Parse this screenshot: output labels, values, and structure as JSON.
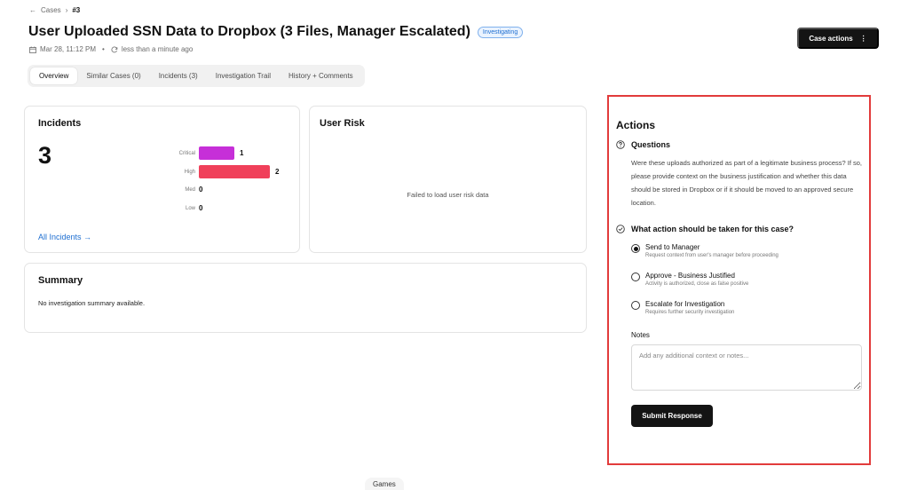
{
  "breadcrumb": {
    "back_icon": "arrow-left-icon",
    "parent": "Cases",
    "separator": "›",
    "current": "#3"
  },
  "case": {
    "title": "User Uploaded SSN Data to Dropbox (3 Files, Manager Escalated)",
    "status": "Investigating",
    "date": "Mar 28, 11:12 PM",
    "dot": "•",
    "updated": "less than a minute ago"
  },
  "header": {
    "case_actions_label": "Case actions",
    "more_icon": "⋮"
  },
  "tabs": [
    {
      "label": "Overview",
      "active": true
    },
    {
      "label": "Similar Cases (0)",
      "active": false
    },
    {
      "label": "Incidents (3)",
      "active": false
    },
    {
      "label": "Investigation Trail",
      "active": false
    },
    {
      "label": "History + Comments",
      "active": false
    }
  ],
  "incidents": {
    "title": "Incidents",
    "total": "3",
    "severities": [
      {
        "label": "Critical",
        "count": 1,
        "color": "#c62fd8"
      },
      {
        "label": "High",
        "count": 2,
        "color": "#f0405a"
      },
      {
        "label": "Med",
        "count": 0,
        "color": "#f0a040"
      },
      {
        "label": "Low",
        "count": 0,
        "color": "#4caf50"
      }
    ],
    "link": "All Incidents →"
  },
  "user_risk": {
    "title": "User Risk",
    "message": "Failed to load user risk data"
  },
  "summary": {
    "title": "Summary",
    "text": "No investigation summary available."
  },
  "actions": {
    "title": "Actions",
    "questions_title": "Questions",
    "questions_body": "Were these uploads authorized as part of a legitimate business process? If so, please provide context on the business justification and whether this data should be stored in Dropbox or if it should be moved to an approved secure location.",
    "action_title": "What action should be taken for this case?",
    "options": [
      {
        "title": "Send to Manager",
        "desc": "Request context from user's manager before proceeding",
        "selected": true
      },
      {
        "title": "Approve - Business Justified",
        "desc": "Activity is authorized, close as false positive",
        "selected": false
      },
      {
        "title": "Escalate for Investigation",
        "desc": "Requires further security investigation",
        "selected": false
      }
    ],
    "notes_label": "Notes",
    "notes_placeholder": "Add any additional context or notes...",
    "notes_value": "",
    "submit_label": "Submit Response"
  },
  "footer": {
    "games_label": "Games"
  },
  "colors": {
    "accent": "#1f6fd1",
    "highlight_border": "#e23b3b",
    "button_bg": "#141414"
  }
}
